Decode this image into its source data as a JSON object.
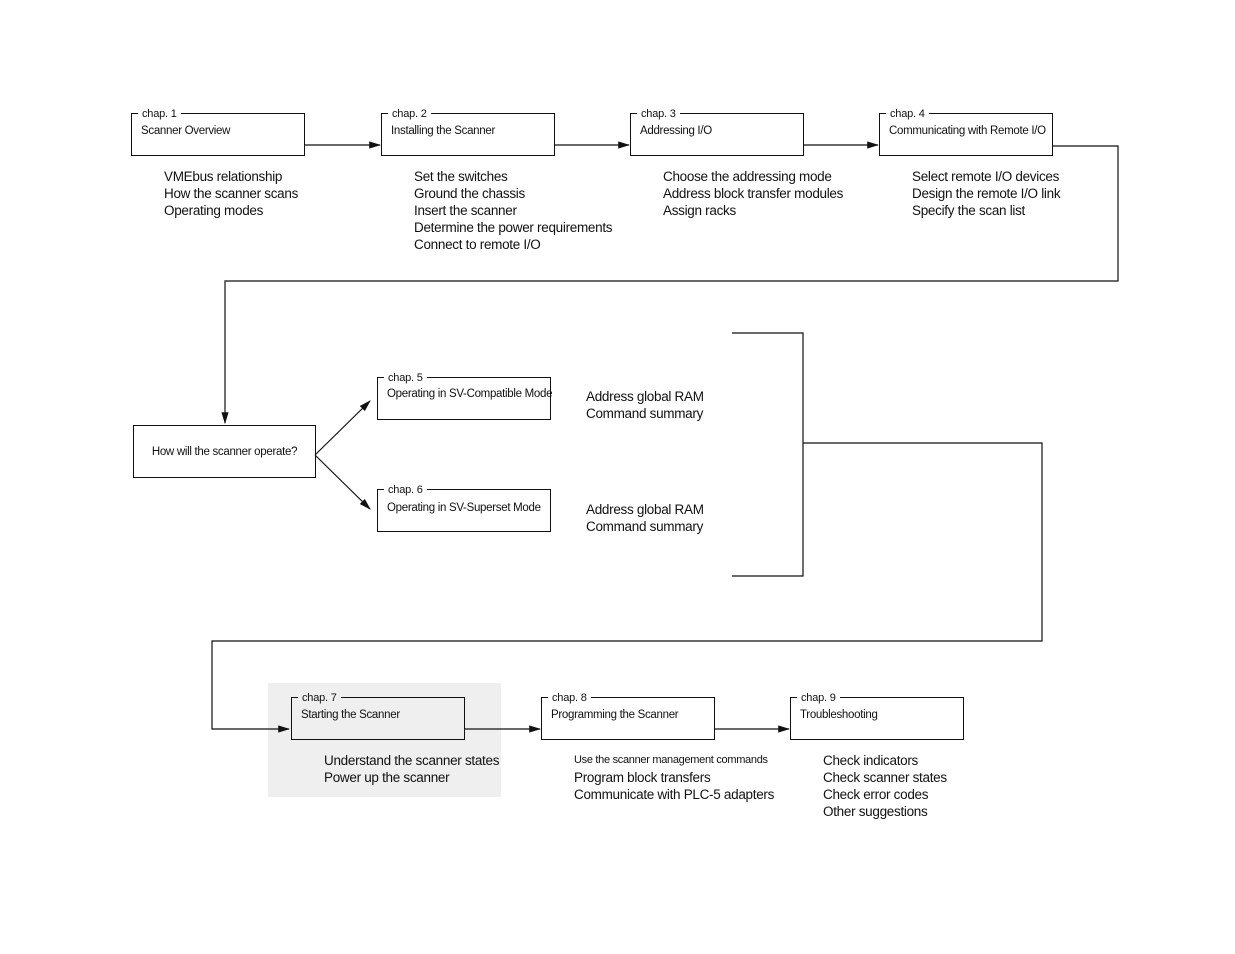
{
  "chapters": [
    {
      "label": "chap. 1",
      "title": "Scanner Overview",
      "items": [
        "VMEbus relationship",
        "How the scanner scans",
        "Operating modes"
      ]
    },
    {
      "label": "chap. 2",
      "title": "Installing the Scanner",
      "items": [
        "Set the switches",
        "Ground the chassis",
        "Insert the scanner",
        "Determine the power requirements",
        "Connect to remote I/O"
      ]
    },
    {
      "label": "chap. 3",
      "title": "Addressing I/O",
      "items": [
        "Choose the addressing mode",
        "Address block transfer modules",
        "Assign racks"
      ]
    },
    {
      "label": "chap. 4",
      "title": "Communicating with Remote I/O",
      "items": [
        "Select remote I/O devices",
        "Design the remote I/O link",
        "Specify the scan list"
      ]
    },
    {
      "label": "chap. 5",
      "title": "Operating in SV-Compatible Mode",
      "items": [
        "Address global RAM",
        "Command summary"
      ]
    },
    {
      "label": "chap. 6",
      "title": "Operating in SV-Superset Mode",
      "items": [
        "Address global RAM",
        "Command summary"
      ]
    },
    {
      "label": "chap. 7",
      "title": "Starting the Scanner",
      "items": [
        "Understand the scanner states",
        "Power up the scanner"
      ]
    },
    {
      "label": "chap. 8",
      "title": "Programming the Scanner",
      "items": [
        "Use the scanner management commands",
        "Program block transfers",
        "Communicate with PLC-5 adapters"
      ]
    },
    {
      "label": "chap. 9",
      "title": "Troubleshooting",
      "items": [
        "Check indicators",
        "Check scanner states",
        "Check error codes",
        "Other suggestions"
      ]
    }
  ],
  "decision": "How will the scanner operate?",
  "colors": {
    "line": "#111111",
    "highlight": "#efefef"
  }
}
